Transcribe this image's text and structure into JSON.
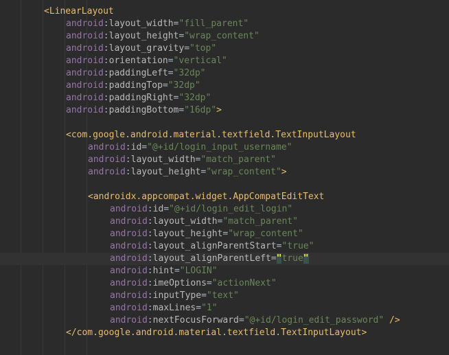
{
  "editor": {
    "lines": [
      {
        "indent": 64,
        "tag_open": "<LinearLayout"
      },
      {
        "indent": 96,
        "ns": "android",
        "attr": "layout_width",
        "value": "\"fill_parent\""
      },
      {
        "indent": 96,
        "ns": "android",
        "attr": "layout_height",
        "value": "\"wrap_content\""
      },
      {
        "indent": 96,
        "ns": "android",
        "attr": "layout_gravity",
        "value": "\"top\""
      },
      {
        "indent": 96,
        "ns": "android",
        "attr": "orientation",
        "value": "\"vertical\""
      },
      {
        "indent": 96,
        "ns": "android",
        "attr": "paddingLeft",
        "value": "\"32dp\""
      },
      {
        "indent": 96,
        "ns": "android",
        "attr": "paddingTop",
        "value": "\"32dp\""
      },
      {
        "indent": 96,
        "ns": "android",
        "attr": "paddingRight",
        "value": "\"32dp\""
      },
      {
        "indent": 96,
        "ns": "android",
        "attr": "paddingBottom",
        "value": "\"16dp\"",
        "tail": ">"
      },
      {
        "indent": 96,
        "tag_open": ""
      },
      {
        "indent": 96,
        "tag_open": "<com.google.android.material.textfield.TextInputLayout"
      },
      {
        "indent": 128,
        "ns": "android",
        "attr": "id",
        "value": "\"@+id/login_input_username\""
      },
      {
        "indent": 128,
        "ns": "android",
        "attr": "layout_width",
        "value": "\"match_parent\""
      },
      {
        "indent": 128,
        "ns": "android",
        "attr": "layout_height",
        "value": "\"wrap_content\"",
        "tail": ">"
      },
      {
        "indent": 128,
        "tag_open": ""
      },
      {
        "indent": 128,
        "tag_open": "<androidx.appcompat.widget.AppCompatEditText"
      },
      {
        "indent": 160,
        "ns": "android",
        "attr": "id",
        "value": "\"@+id/login_edit_login\""
      },
      {
        "indent": 160,
        "ns": "android",
        "attr": "layout_width",
        "value": "\"match_parent\""
      },
      {
        "indent": 160,
        "ns": "android",
        "attr": "layout_height",
        "value": "\"wrap_content\""
      },
      {
        "indent": 160,
        "ns": "android",
        "attr": "layout_alignParentStart",
        "value": "\"true\""
      },
      {
        "indent": 160,
        "ns": "android",
        "attr": "layout_alignParentLeft",
        "value": "\"true\"",
        "caret": true
      },
      {
        "indent": 160,
        "ns": "android",
        "attr": "hint",
        "value": "\"LOGIN\""
      },
      {
        "indent": 160,
        "ns": "android",
        "attr": "imeOptions",
        "value": "\"actionNext\""
      },
      {
        "indent": 160,
        "ns": "android",
        "attr": "inputType",
        "value": "\"text\""
      },
      {
        "indent": 160,
        "ns": "android",
        "attr": "maxLines",
        "value": "\"1\""
      },
      {
        "indent": 160,
        "ns": "android",
        "attr": "nextFocusForward",
        "value": "\"@+id/login_edit_password\"",
        "tail": " />"
      },
      {
        "indent": 96,
        "tag_open": "</com.google.android.material.textfield.TextInputLayout>"
      }
    ]
  }
}
